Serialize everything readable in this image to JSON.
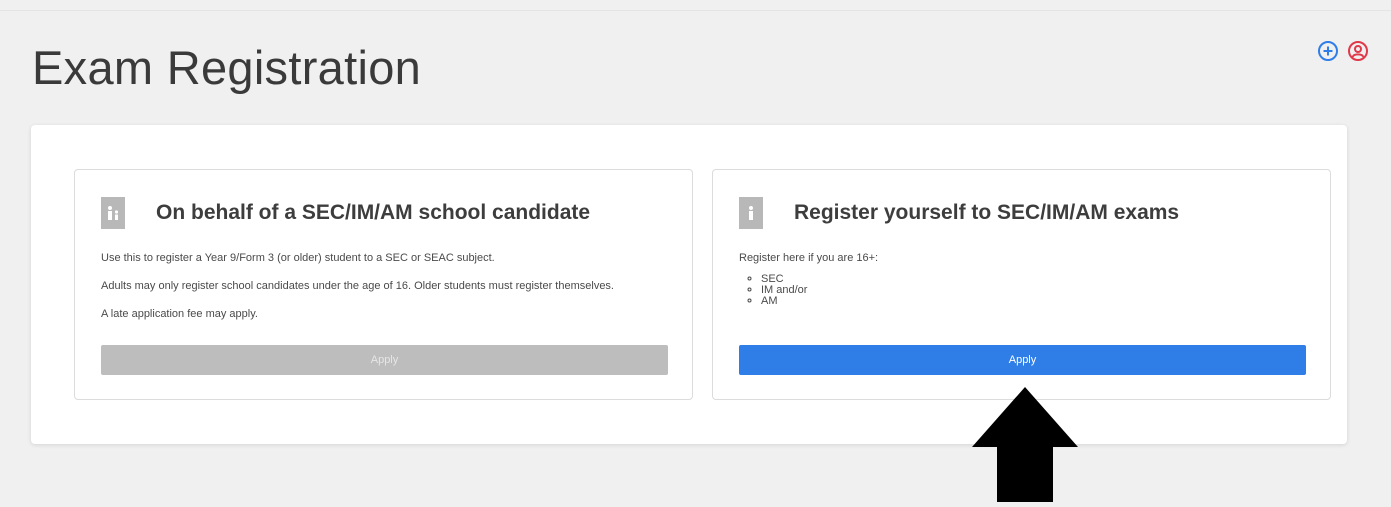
{
  "header": {
    "title": "Exam Registration",
    "icons": [
      "add-circle-icon",
      "user-circle-icon"
    ],
    "add_icon_color": "#2f7ee8",
    "user_icon_color": "#e0394a"
  },
  "cards": [
    {
      "icon": "parent-child-icon",
      "title": "On behalf of a SEC/IM/AM school candidate",
      "paragraphs": [
        "Use this to register a Year 9/Form 3 (or older) student to a SEC or SEAC subject.",
        "Adults may only register school candidates under the age of 16. Older students must register themselves.",
        "A late application fee may apply."
      ],
      "button_label": "Apply",
      "button_state": "disabled"
    },
    {
      "icon": "person-icon",
      "title": "Register yourself to SEC/IM/AM exams",
      "intro": "Register here if you are 16+:",
      "list": [
        "SEC",
        "IM and/or",
        "AM"
      ],
      "button_label": "Apply",
      "button_state": "enabled"
    }
  ],
  "colors": {
    "primary": "#2f7ee8",
    "disabled": "#bdbdbd",
    "background": "#f0f0f0"
  }
}
